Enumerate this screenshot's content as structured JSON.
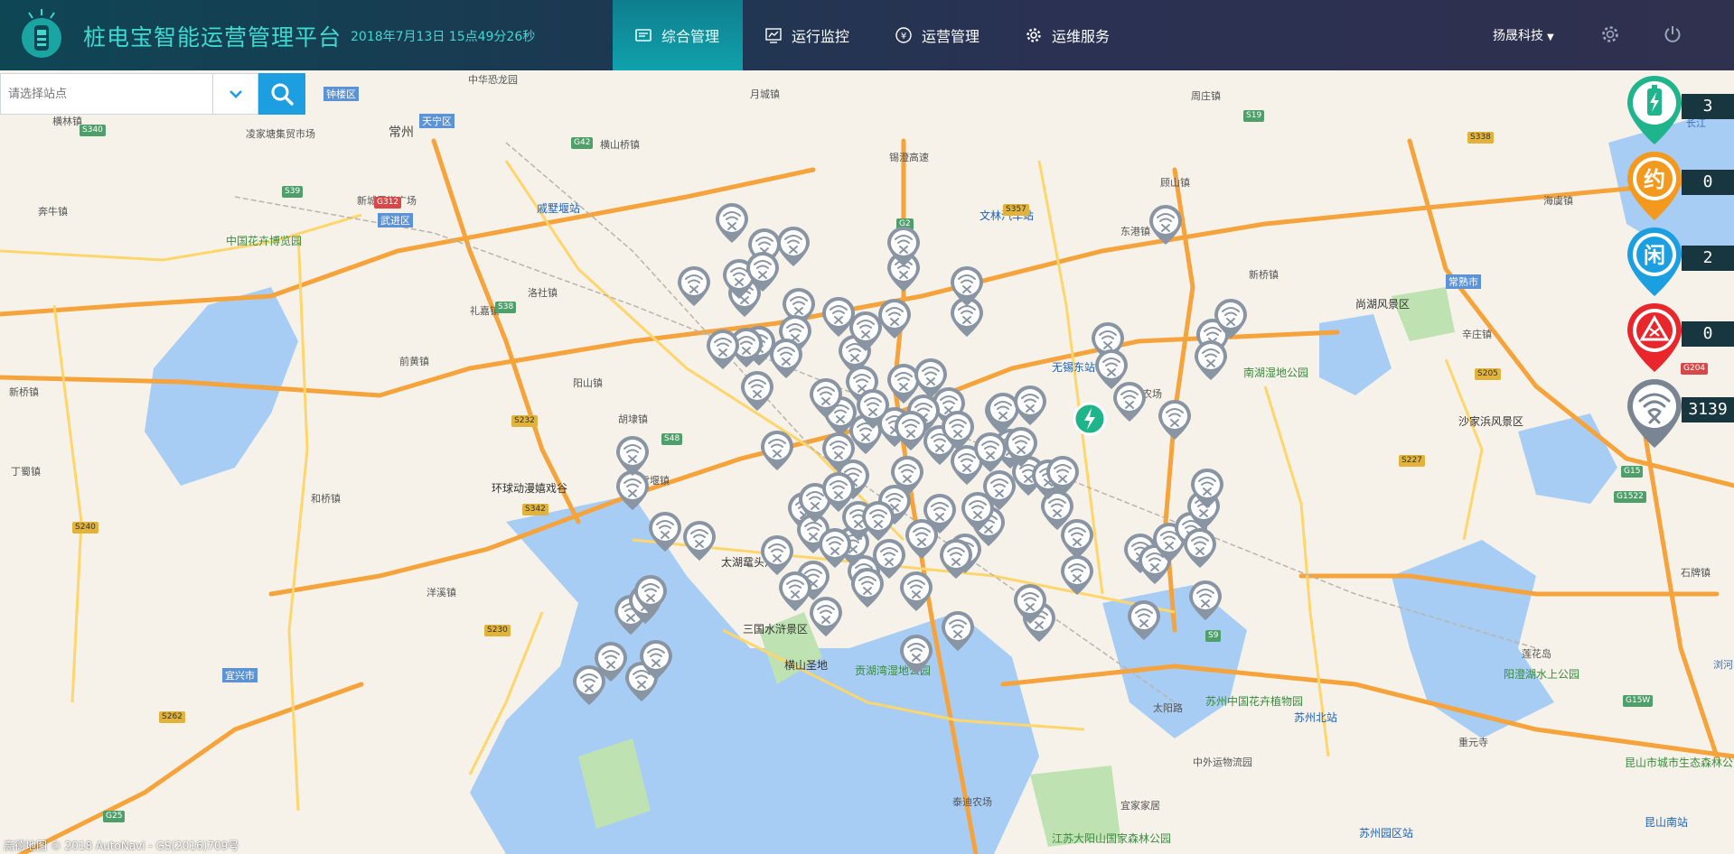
{
  "header": {
    "title": "桩电宝智能运营管理平台",
    "datetime": "2018年7月13日  15点49分26秒",
    "nav": [
      {
        "label": "综合管理",
        "icon": "dashboard-icon",
        "active": true
      },
      {
        "label": "运行监控",
        "icon": "chart-icon",
        "active": false
      },
      {
        "label": "运营管理",
        "icon": "yuan-icon",
        "active": false
      },
      {
        "label": "运维服务",
        "icon": "gear-icon",
        "active": false
      }
    ],
    "user": "扬晟科技"
  },
  "search": {
    "placeholder": "请选择站点"
  },
  "legend": [
    {
      "label": "充电中",
      "icon": "battery-charging-icon",
      "color": "#1fb48c",
      "count": "3"
    },
    {
      "label": "约",
      "icon": "reserved-icon",
      "color": "#f39a1e",
      "count": "0"
    },
    {
      "label": "闲",
      "icon": "idle-icon",
      "color": "#1b9fe0",
      "count": "2"
    },
    {
      "label": "故障",
      "icon": "fault-icon",
      "color": "#e8262b",
      "count": "0"
    },
    {
      "label": "离线",
      "icon": "offline-wifi-icon",
      "color": "#7a8593",
      "count": "3139"
    }
  ],
  "map": {
    "places": [
      "中华恐龙园",
      "钟楼区",
      "天宁区",
      "常州",
      "凌家塘集贸市场",
      "新城吾悦广场",
      "武进区",
      "中国花卉博览园",
      "奔牛镇",
      "横林镇",
      "戚墅堰站",
      "洛社镇",
      "礼嘉镇",
      "前黄镇",
      "阳山镇",
      "胡埭镇",
      "雪堰镇",
      "环球动漫嬉戏谷",
      "和桥镇",
      "洋溪镇",
      "宜兴市",
      "丁蜀镇",
      "新桥镇",
      "月城镇",
      "横山桥镇",
      "锡澄高速",
      "文林汽车站",
      "东港镇",
      "顾山镇",
      "周庄镇",
      "新桥镇",
      "尚湖风景区",
      "常熟市",
      "南湖湿地公园",
      "沙家浜风景区",
      "无锡东站",
      "五七农场",
      "太湖鼋头渚",
      "三国水浒景区",
      "横山圣地",
      "贡湖湾湿地公园",
      "泰迪农场",
      "苏州中国花卉植物园",
      "苏州北站",
      "太阳路",
      "中外运物流园",
      "宜家家居",
      "江苏大阳山国家森林公园",
      "苏州园区站",
      "阳澄湖水上公园",
      "莲花岛",
      "重元寺",
      "昆山市城市生态森林公园",
      "昆山南站",
      "长江",
      "浏河",
      "石牌镇",
      "辛庄镇",
      "海虞镇"
    ],
    "roads": [
      "S340",
      "S39",
      "G312",
      "S38",
      "G42",
      "S357",
      "S19",
      "G2",
      "S232",
      "S48",
      "S342",
      "G15",
      "S338",
      "S240",
      "G25",
      "S262",
      "S230",
      "S9",
      "G204",
      "S205",
      "S227",
      "G1522",
      "G15W"
    ],
    "copyright": "高德地图 © 2018 AutoNavi - GS(2016)709号"
  }
}
